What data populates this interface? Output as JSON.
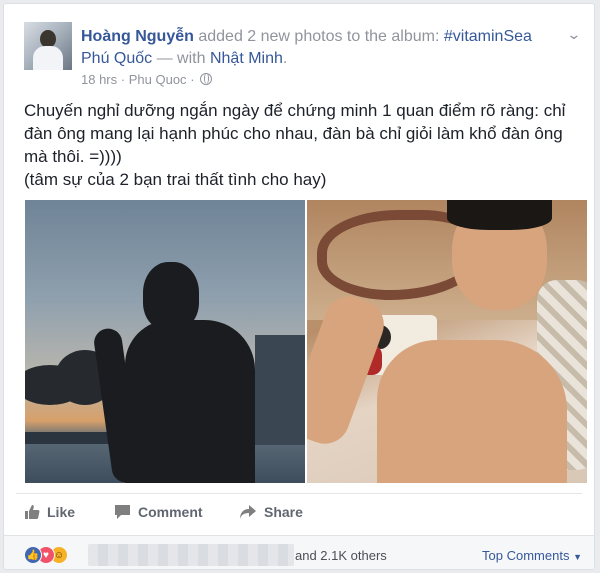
{
  "post": {
    "author": "Hoàng Nguyễn",
    "action_text": "added 2 new photos to the album:",
    "album": "#vitaminSea",
    "location": "Phú Quốc",
    "with_prefix": "— with",
    "tagged": "Nhật Minh",
    "time": "18 hrs",
    "place_short": "Phu Quoc",
    "meta_sep": "·",
    "text_line1": "Chuyến nghỉ dưỡng ngắn ngày để chứng minh 1 quan điểm rõ ràng: chỉ đàn ông mang lại hạnh phúc cho nhau, đàn bà chỉ giỏi làm khổ đàn ông mà thôi. =))))",
    "text_line2": "(tâm sự của 2 bạn trai thất tình cho hay)"
  },
  "actions": {
    "like": "Like",
    "comment": "Comment",
    "share": "Share"
  },
  "footer": {
    "others_text": "and 2.1K others",
    "top_comments": "Top Comments"
  },
  "icons": {
    "menu": "chevron-down-icon",
    "privacy": "globe-icon",
    "like": "thumbs-up-icon",
    "comment": "speech-bubble-icon",
    "share": "share-arrow-icon"
  },
  "colors": {
    "link": "#365899",
    "muted": "#90949c",
    "like_blue": "#4267b2",
    "love_red": "#f25268",
    "haha_yellow": "#f7b125"
  }
}
